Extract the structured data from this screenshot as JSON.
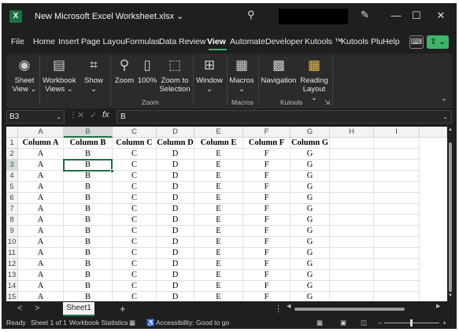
{
  "window": {
    "title": "New Microsoft Excel Worksheet.xlsx ⌄",
    "app_icon": "X",
    "min_label": "—",
    "max_label": "☐",
    "close_label": "✕"
  },
  "menu": [
    "File",
    "Home",
    "Insert",
    "Page Layou",
    "Formulas",
    "Data",
    "Review",
    "View",
    "Automate",
    "Developer",
    "Kutools ™",
    "Kutools Plu",
    "Help"
  ],
  "menu_active": "View",
  "ribbon": {
    "sheet_view": [
      "Sheet",
      "View ⌄"
    ],
    "workbook_views": [
      "Workbook",
      "Views ⌄"
    ],
    "show": [
      "Show",
      "⌄"
    ],
    "zoom": "Zoom",
    "zoom100": "100%",
    "zoom_to_selection": [
      "Zoom to",
      "Selection"
    ],
    "window": [
      "Window",
      "⌄"
    ],
    "macros": [
      "Macros",
      "⌄"
    ],
    "navigation": "Navigation",
    "reading_layout": [
      "Reading",
      "Layout ⌄"
    ],
    "groups": {
      "zoom": "Zoom",
      "macros": "Macros",
      "kutools": "Kutools"
    }
  },
  "formula_bar": {
    "name_box": "B3",
    "value": "B"
  },
  "grid": {
    "columns": [
      "A",
      "B",
      "C",
      "D",
      "E",
      "F",
      "G",
      "H",
      "I"
    ],
    "rows": [
      "1",
      "2",
      "3",
      "4",
      "5",
      "6",
      "7",
      "8",
      "9",
      "10",
      "11",
      "12",
      "13",
      "14",
      "15"
    ],
    "selected_cell": "B3",
    "header_row": [
      "Column A",
      "Column B",
      "Column C",
      "Column D",
      "Column E",
      "Column F",
      "Column G"
    ],
    "data_row": [
      "A",
      "B",
      "C",
      "D",
      "E",
      "F",
      "G"
    ]
  },
  "sheet_tabs": {
    "prev": "<",
    "next": ">",
    "active": "Sheet1",
    "add": "+"
  },
  "status": {
    "ready": "Ready",
    "sheet_info": "Sheet 1 of 1",
    "workbook_stats": "Workbook Statistics",
    "accessibility": "Accessibility: Good to go",
    "zoom_minus": "–",
    "zoom_plus": "+"
  }
}
